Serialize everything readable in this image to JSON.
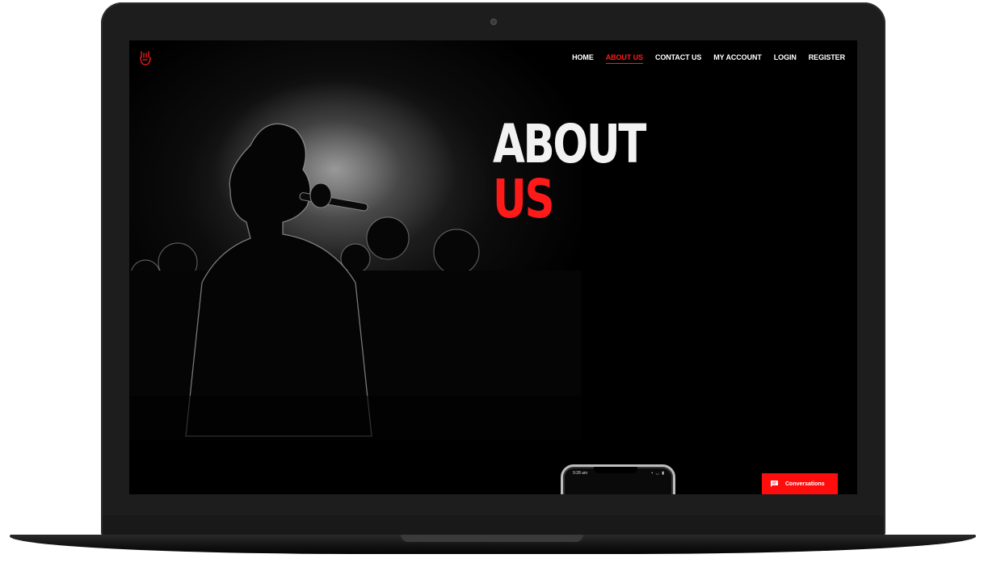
{
  "nav": {
    "items": [
      {
        "label": "HOME",
        "active": false
      },
      {
        "label": "ABOUT US",
        "active": true
      },
      {
        "label": "CONTACT US",
        "active": false
      },
      {
        "label": "MY ACCOUNT",
        "active": false
      },
      {
        "label": "LOGIN",
        "active": false
      },
      {
        "label": "REGISTER",
        "active": false
      }
    ]
  },
  "hero": {
    "title_line1": "ABOUT",
    "title_line2": "US"
  },
  "phone": {
    "time": "9:28 am",
    "status": "▪ ◡ ▮"
  },
  "chat": {
    "label": "Conversations"
  },
  "logo": {
    "icon": "rock-hand-icon"
  },
  "colors": {
    "accent": "#ff1a1a",
    "background": "#000000",
    "nav_text": "#ffffff",
    "laptop_frame": "#1d1d1d"
  }
}
